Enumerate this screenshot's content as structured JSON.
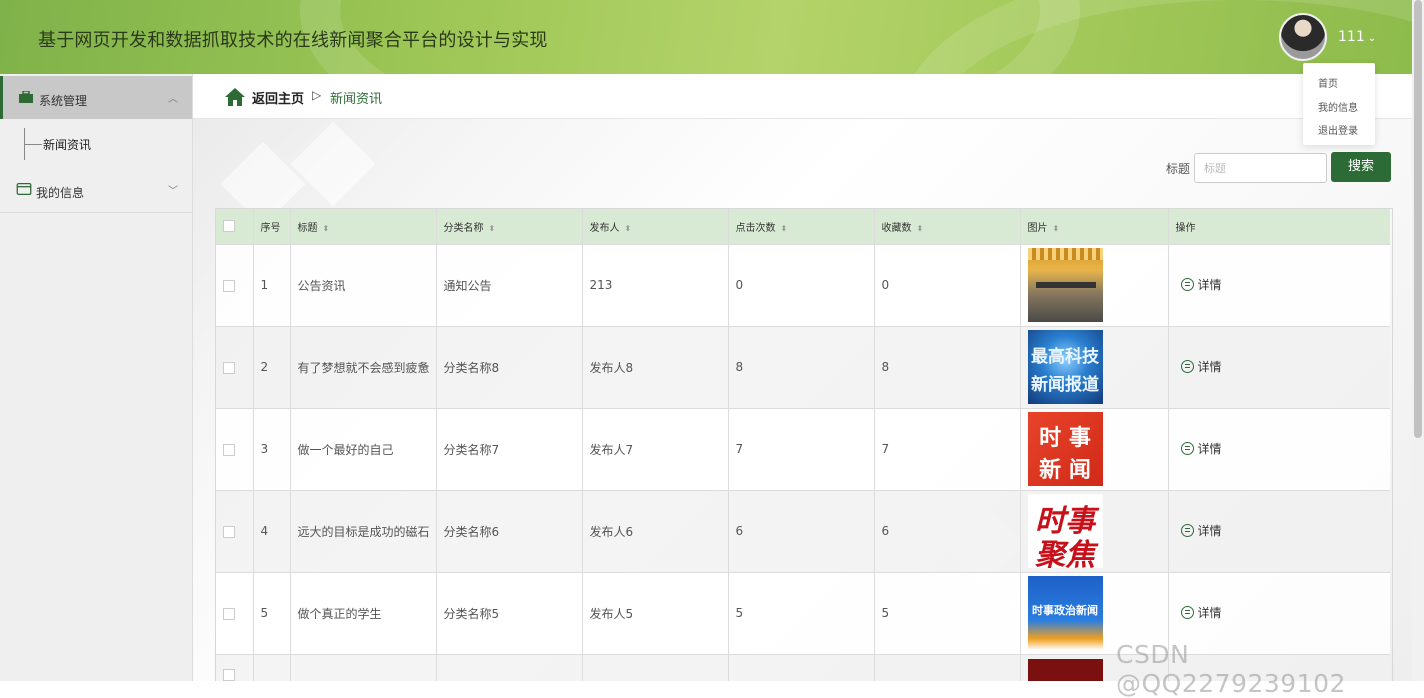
{
  "header": {
    "title": "基于网页开发和数据抓取技术的在线新闻聚合平台的设计与实现",
    "user_name": "111",
    "dropdown": [
      "首页",
      "我的信息",
      "退出登录"
    ]
  },
  "sidebar": {
    "groups": [
      {
        "label": "系统管理",
        "arrow": "︿",
        "items": [
          "新闻资讯"
        ]
      },
      {
        "label": "我的信息",
        "arrow": "﹀"
      }
    ]
  },
  "breadcrumb": {
    "home": "返回主页",
    "separator": "▷",
    "current": "新闻资讯"
  },
  "search": {
    "label": "标题",
    "placeholder": "标题",
    "button": "搜索"
  },
  "table": {
    "headers": [
      "序号",
      "标题",
      "分类名称",
      "发布人",
      "点击次数",
      "收藏数",
      "图片",
      "操作"
    ],
    "action_label": "详情",
    "rows": [
      {
        "id": "1",
        "title": "公告资讯",
        "category": "通知公告",
        "publisher": "213",
        "clicks": "0",
        "favorites": "0"
      },
      {
        "id": "2",
        "title": "有了梦想就不会感到疲惫",
        "category": "分类名称8",
        "publisher": "发布人8",
        "clicks": "8",
        "favorites": "8"
      },
      {
        "id": "3",
        "title": "做一个最好的自己",
        "category": "分类名称7",
        "publisher": "发布人7",
        "clicks": "7",
        "favorites": "7"
      },
      {
        "id": "4",
        "title": "远大的目标是成功的磁石",
        "category": "分类名称6",
        "publisher": "发布人6",
        "clicks": "6",
        "favorites": "6"
      },
      {
        "id": "5",
        "title": "做个真正的学生",
        "category": "分类名称5",
        "publisher": "发布人5",
        "clicks": "5",
        "favorites": "5"
      }
    ],
    "thumbs": [
      {
        "line1": "",
        "line2": ""
      },
      {
        "line1": "最高科技",
        "line2": "新闻报道"
      },
      {
        "line1": "时 事",
        "line2": "新 闻"
      },
      {
        "line1": "时事",
        "line2": "聚焦"
      },
      {
        "line1": "时事政治新闻",
        "line2": ""
      }
    ]
  },
  "watermark": "CSDN @QQ2279239102"
}
